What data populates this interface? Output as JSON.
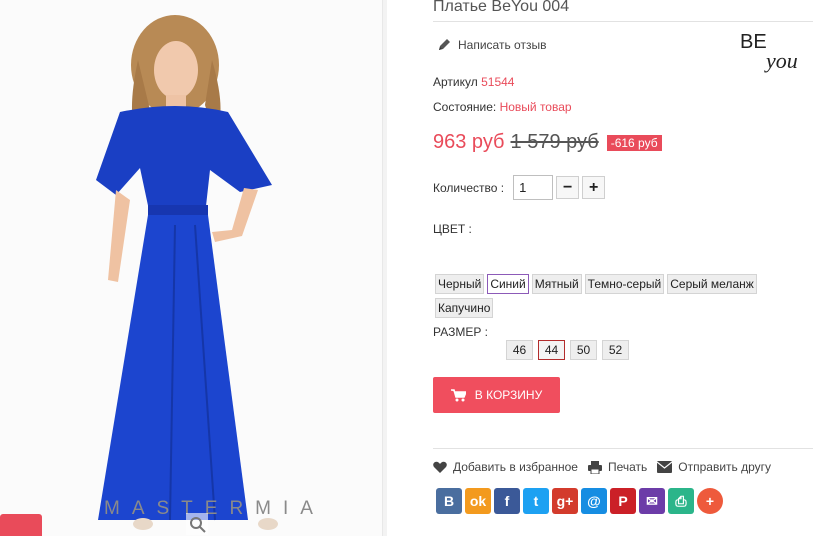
{
  "product": {
    "title": "Платье BeYou 004",
    "review_label": "Написать отзыв",
    "brand_logo_text": "BE you",
    "article_label": "Артикул",
    "article_value": "51544",
    "condition_label": "Состояние:",
    "condition_value": "Новый товар",
    "price_new": "963 руб",
    "price_old": "1 579 руб",
    "discount": "-616 руб",
    "watermark": "MASTERMIA"
  },
  "quantity": {
    "label": "Количество :",
    "value": "1",
    "minus": "−",
    "plus": "+"
  },
  "color": {
    "label": "ЦВЕТ :",
    "options": [
      "Черный",
      "Синий",
      "Мятный",
      "Темно-серый",
      "Серый меланж",
      "Капучино"
    ],
    "selected": "Синий"
  },
  "size": {
    "label": "РАЗМЕР :",
    "options": [
      "46",
      "44",
      "50",
      "52"
    ],
    "selected": "44"
  },
  "cart": {
    "label": "В КОРЗИНУ"
  },
  "actions": {
    "favorite": "Добавить в избранное",
    "print": "Печать",
    "send": "Отправить другу"
  },
  "share": [
    {
      "name": "vk",
      "glyph": "B",
      "color": "#4a6e9f"
    },
    {
      "name": "odnoklassniki",
      "glyph": "ok",
      "color": "#f39a1e"
    },
    {
      "name": "facebook",
      "glyph": "f",
      "color": "#3b5998"
    },
    {
      "name": "twitter",
      "glyph": "t",
      "color": "#1da1f2"
    },
    {
      "name": "google-plus",
      "glyph": "g+",
      "color": "#d33b2c"
    },
    {
      "name": "mail-ru",
      "glyph": "@",
      "color": "#168de2"
    },
    {
      "name": "pinterest",
      "glyph": "P",
      "color": "#cb2027"
    },
    {
      "name": "email",
      "glyph": "✉",
      "color": "#6c3ca8"
    },
    {
      "name": "print",
      "glyph": "⎙",
      "color": "#2bb58a"
    },
    {
      "name": "more",
      "glyph": "+",
      "color": "#ee5a3c"
    }
  ],
  "colors": {
    "accent": "#e94b5a",
    "button": "#f04e5e"
  }
}
